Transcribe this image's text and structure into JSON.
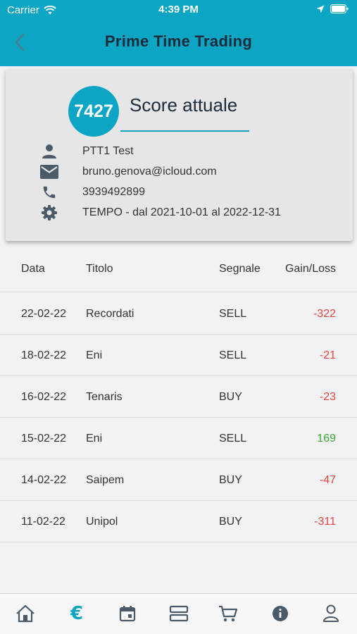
{
  "status_bar": {
    "carrier": "Carrier",
    "time": "4:39 PM"
  },
  "header": {
    "title": "Prime Time Trading"
  },
  "profile": {
    "score": "7427",
    "score_label": "Score attuale",
    "name": "PTT1 Test",
    "email": "bruno.genova@icloud.com",
    "phone": "3939492899",
    "period": "TEMPO - dal 2021-10-01 al 2022-12-31"
  },
  "table": {
    "headers": {
      "date": "Data",
      "title": "Titolo",
      "signal": "Segnale",
      "gain_loss": "Gain/Loss"
    },
    "rows": [
      {
        "date": "22-02-22",
        "title": "Recordati",
        "signal": "SELL",
        "gain_loss": "-322"
      },
      {
        "date": "18-02-22",
        "title": "Eni",
        "signal": "SELL",
        "gain_loss": "-21"
      },
      {
        "date": "16-02-22",
        "title": "Tenaris",
        "signal": "BUY",
        "gain_loss": "-23"
      },
      {
        "date": "15-02-22",
        "title": "Eni",
        "signal": "SELL",
        "gain_loss": "169"
      },
      {
        "date": "14-02-22",
        "title": "Saipem",
        "signal": "BUY",
        "gain_loss": "-47"
      },
      {
        "date": "11-02-22",
        "title": "Unipol",
        "signal": "BUY",
        "gain_loss": "-311"
      }
    ]
  },
  "tab_bar": {
    "items": [
      "home-icon",
      "euro-icon",
      "calendar-icon",
      "list-icon",
      "cart-icon",
      "info-icon",
      "profile-icon"
    ],
    "active": "euro-icon"
  },
  "colors": {
    "accent": "#0ca5c4",
    "loss": "#e8453c",
    "gain": "#3aaa35",
    "icon": "#4a5a68"
  }
}
